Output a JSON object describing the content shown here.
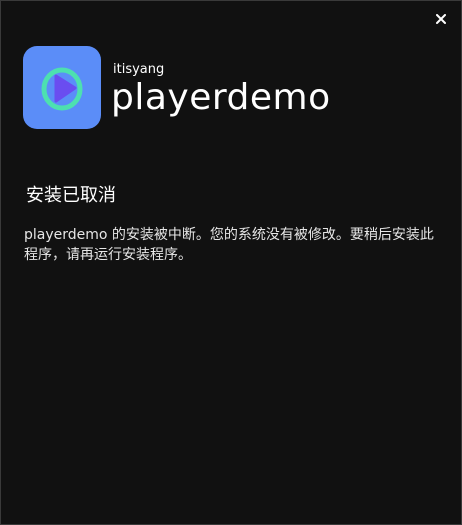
{
  "window": {
    "close_icon": "close-icon"
  },
  "header": {
    "publisher": "itisyang",
    "app_name": "playerdemo",
    "icon": "play-logo-icon",
    "icon_bg_color": "#5b8df8",
    "icon_accent_color": "#4de0b0",
    "icon_play_color": "#6a4df0"
  },
  "main": {
    "status_title": "安装已取消",
    "message": "playerdemo 的安装被中断。您的系统没有被修改。要稍后安装此程序，请再运行安装程序。"
  }
}
